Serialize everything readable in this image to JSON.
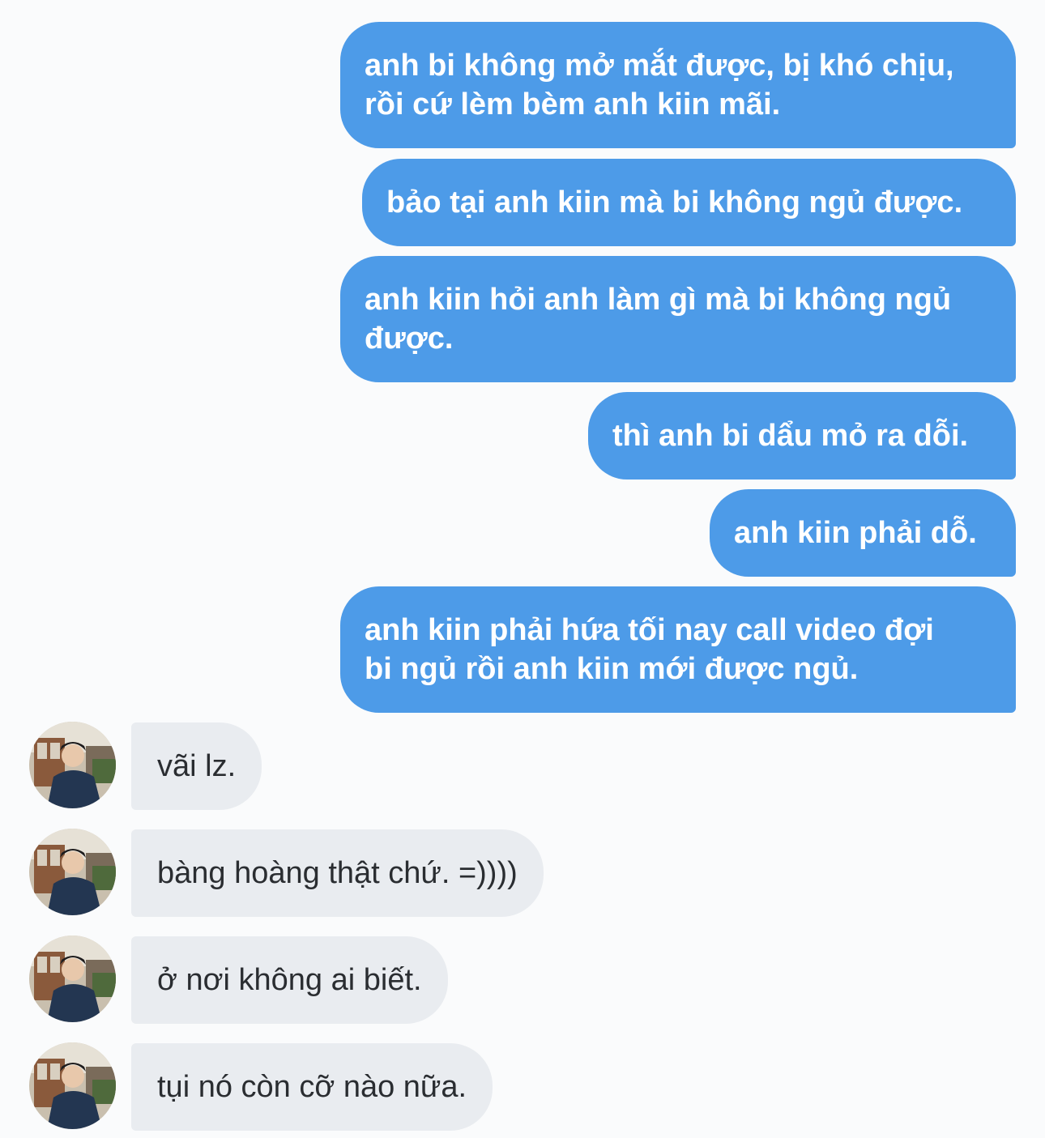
{
  "conversation": {
    "outgoing": [
      {
        "line1": "anh bi không mở mắt được, bị khó chịu,",
        "line2": "rồi cứ lèm bèm anh kiin mãi."
      },
      {
        "line1": "bảo tại anh kiin mà bi không ngủ được."
      },
      {
        "line1": "anh kiin hỏi anh làm gì mà bi không ngủ",
        "line2": "được."
      },
      {
        "line1": "thì anh bi dẩu mỏ ra dỗi."
      },
      {
        "line1": "anh kiin phải dỗ."
      },
      {
        "line1": "anh kiin phải hứa tối nay call video đợi",
        "line2": "bi ngủ rồi anh kiin mới được ngủ."
      }
    ],
    "incoming": [
      {
        "text": "vãi lz."
      },
      {
        "text": "bàng hoàng thật chứ. =))))"
      },
      {
        "text": "ở nơi không ai biết."
      },
      {
        "text": "tụi nó còn cỡ nào nữa."
      }
    ]
  },
  "colors": {
    "outgoing_bubble": "#4d9be8",
    "incoming_bubble": "#e9ecf0",
    "background": "#fafbfc"
  },
  "icons": {
    "avatar": "user-avatar-photo"
  }
}
